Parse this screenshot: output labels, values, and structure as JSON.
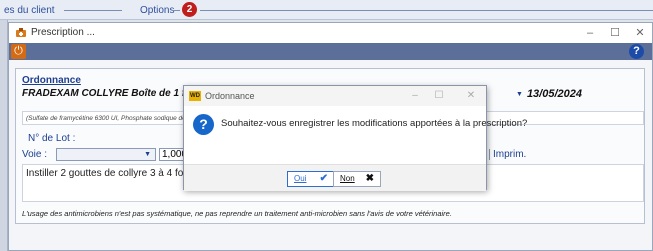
{
  "background": {
    "tab1_label": "es du client",
    "tab2_label": "Options",
    "badge_count": "2"
  },
  "window": {
    "title": "Prescription ...",
    "minimize": "–",
    "maximize": "☐",
    "close": "✕"
  },
  "toolbar": {
    "power_icon": "⏻",
    "help_icon": "?"
  },
  "prescription": {
    "section_title": "Ordonnance",
    "product": "FRADEXAM COLLYRE  Boîte de 1 flacon",
    "date": "13/05/2024",
    "composition": "(Sulfate de framycétine 6300 UI, Phosphate sodique de",
    "lot_label": "N° de Lot :",
    "p_label": "P",
    "voie_label": "Voie :",
    "voie_value": "",
    "quantity": "1,000",
    "imprim_label": "Imprim.",
    "instructions": "Instiller 2 gouttes de collyre 3 à 4 fois par",
    "warning": "L'usage des antimicrobiens n'est pas systématique, ne pas reprendre un traitement anti-microbien sans l'avis de votre vétérinaire."
  },
  "dialog": {
    "logo_text": "WD",
    "title": "Ordonnance",
    "minimize": "–",
    "maximize": "☐",
    "close": "✕",
    "message": "Souhaitez-vous enregistrer les modifications apportées à la prescription?",
    "yes_label": "Oui",
    "yes_mark": "✔",
    "no_label": "Non",
    "no_mark": "✖"
  },
  "colors": {
    "accent": "#1d3f8f",
    "toolbar": "#5c6f99",
    "badge": "#c21d1d",
    "dialog_icon": "#1667c9"
  }
}
